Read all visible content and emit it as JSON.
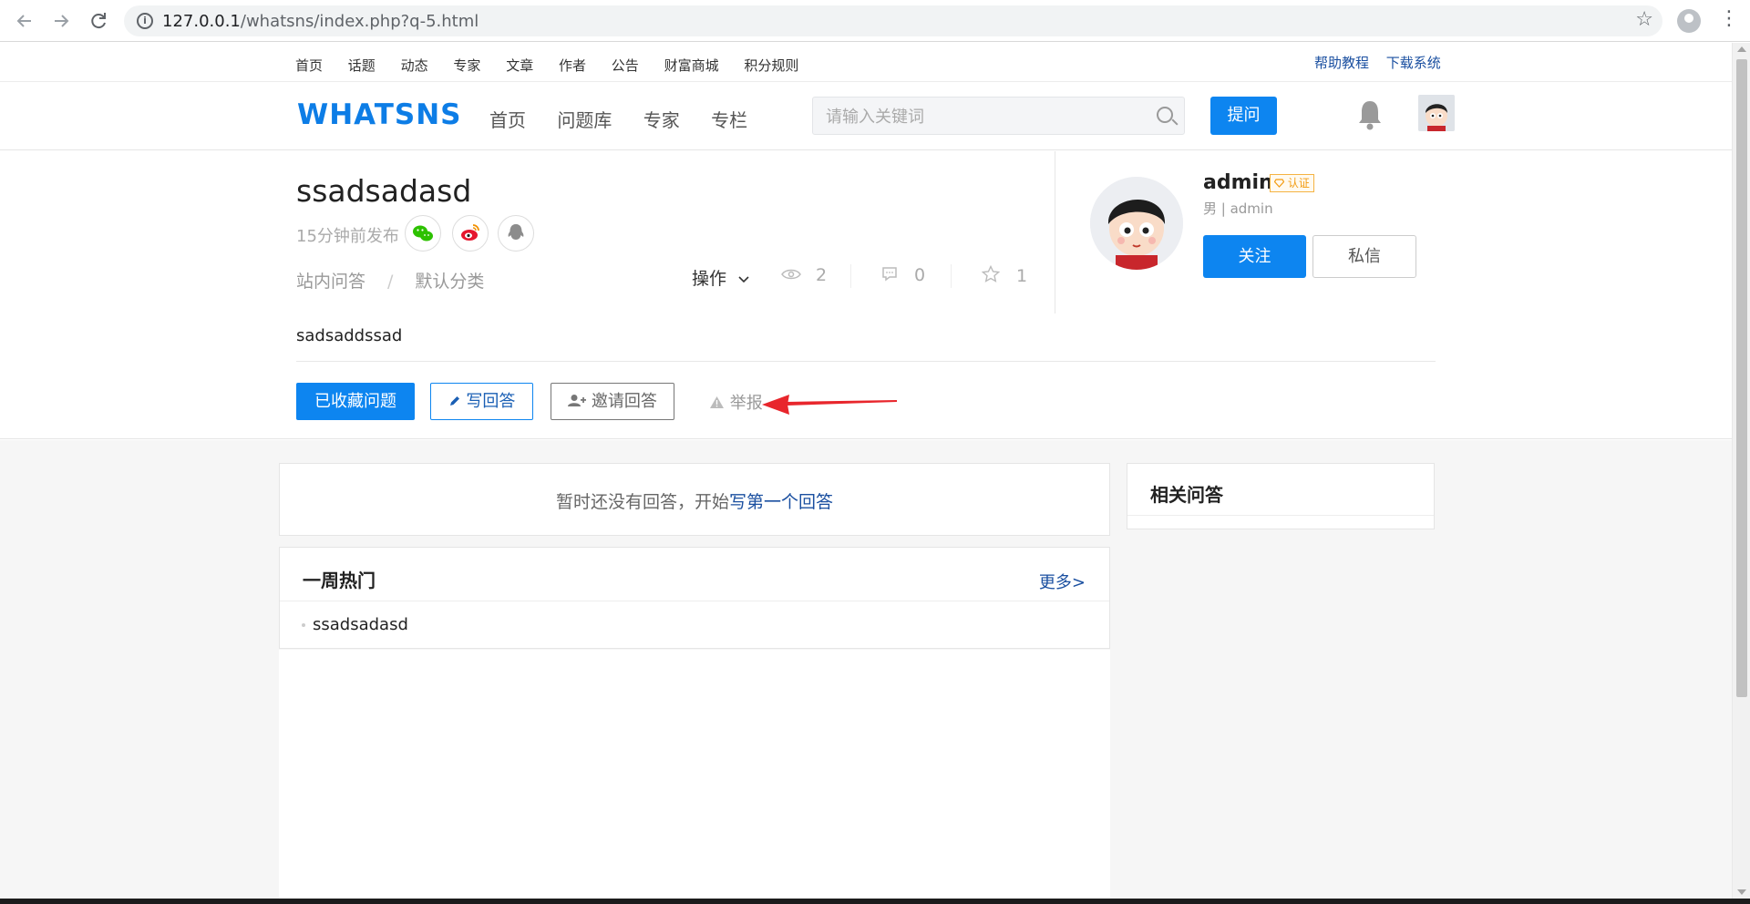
{
  "browser": {
    "url_host": "127.0.0.1",
    "url_path": "/whatsns/index.php?q-5.html",
    "back_icon": "back-arrow-icon",
    "forward_icon": "forward-arrow-icon",
    "reload_icon": "reload-icon"
  },
  "topbar": {
    "links": [
      "首页",
      "话题",
      "动态",
      "专家",
      "文章",
      "作者",
      "公告",
      "财富商城",
      "积分规则"
    ],
    "right_links": [
      "帮助教程",
      "下载系统"
    ]
  },
  "header": {
    "logo": "WHATSNS",
    "nav": [
      "首页",
      "问题库",
      "专家",
      "专栏"
    ],
    "search_placeholder": "请输入关键词",
    "ask_label": "提问"
  },
  "question": {
    "title": "ssadsadasd",
    "time": "15分钟前发布",
    "crumb_1": "站内问答",
    "crumb_sep": "/",
    "crumb_2": "默认分类",
    "ops_label": "操作",
    "views": "2",
    "comments": "0",
    "favorites": "1",
    "content": "sadsaddssad",
    "btn_collected": "已收藏问题",
    "btn_answer": "写回答",
    "btn_invite": "邀请回答",
    "report": "举报"
  },
  "author": {
    "name": "admin",
    "badge": "认证",
    "sub": "男 | admin",
    "follow": "关注",
    "message": "私信"
  },
  "answers": {
    "empty_prefix": "暂时还没有回答，开始",
    "empty_link": "写第一个回答"
  },
  "hot": {
    "title": "一周热门",
    "more": "更多>",
    "items": [
      "ssadsadasd"
    ]
  },
  "related": {
    "title": "相关问答"
  },
  "colors": {
    "primary": "#0d85f0",
    "logo": "#0d7de6",
    "link": "#1a4fa0",
    "annotation_arrow": "#e8262c"
  }
}
